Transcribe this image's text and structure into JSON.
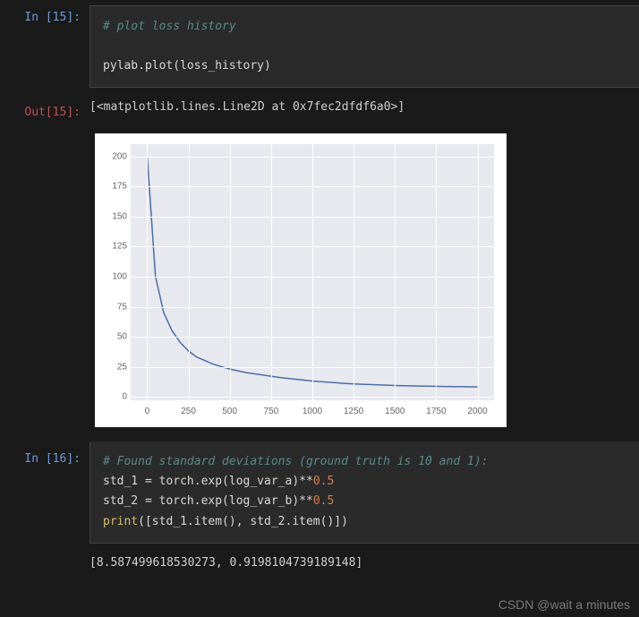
{
  "cell1": {
    "prompt": "In [15]:",
    "comment": "# plot loss history",
    "code": "pylab.plot(loss_history)"
  },
  "out1": {
    "prompt": "Out[15]:",
    "repr": "[<matplotlib.lines.Line2D at 0x7fec2dfdf6a0>]"
  },
  "chart_data": {
    "type": "line",
    "title": "",
    "xlabel": "",
    "ylabel": "",
    "xlim": [
      -100,
      2100
    ],
    "ylim": [
      -3,
      210
    ],
    "xticks": [
      "0",
      "250",
      "500",
      "750",
      "1000",
      "1250",
      "1500",
      "1750",
      "2000"
    ],
    "yticks": [
      "0",
      "25",
      "50",
      "75",
      "100",
      "125",
      "150",
      "175",
      "200"
    ],
    "x": [
      0,
      50,
      100,
      150,
      200,
      250,
      300,
      400,
      500,
      600,
      700,
      800,
      900,
      1000,
      1100,
      1200,
      1300,
      1400,
      1500,
      1600,
      1700,
      1800,
      1900,
      2000
    ],
    "values": [
      200,
      100,
      70,
      55,
      45,
      38,
      33,
      27,
      23,
      20,
      18,
      16,
      14.5,
      13,
      12,
      11,
      10.3,
      9.8,
      9.3,
      9.0,
      8.7,
      8.5,
      8.3,
      8.1
    ]
  },
  "cell2": {
    "prompt": "In [16]:",
    "comment": "# Found standard deviations (ground truth is 10 and 1):",
    "line1_pre": "std_1 = torch.exp(log_var_a)**",
    "line1_num": "0.5",
    "line2_pre": "std_2 = torch.exp(log_var_b)**",
    "line2_num": "0.5",
    "line3_print": "print",
    "line3_rest": "([std_1.item(), std_2.item()])"
  },
  "out2": {
    "text": "[8.587499618530273, 0.9198104739189148]"
  },
  "watermark": "CSDN @wait a minutes"
}
